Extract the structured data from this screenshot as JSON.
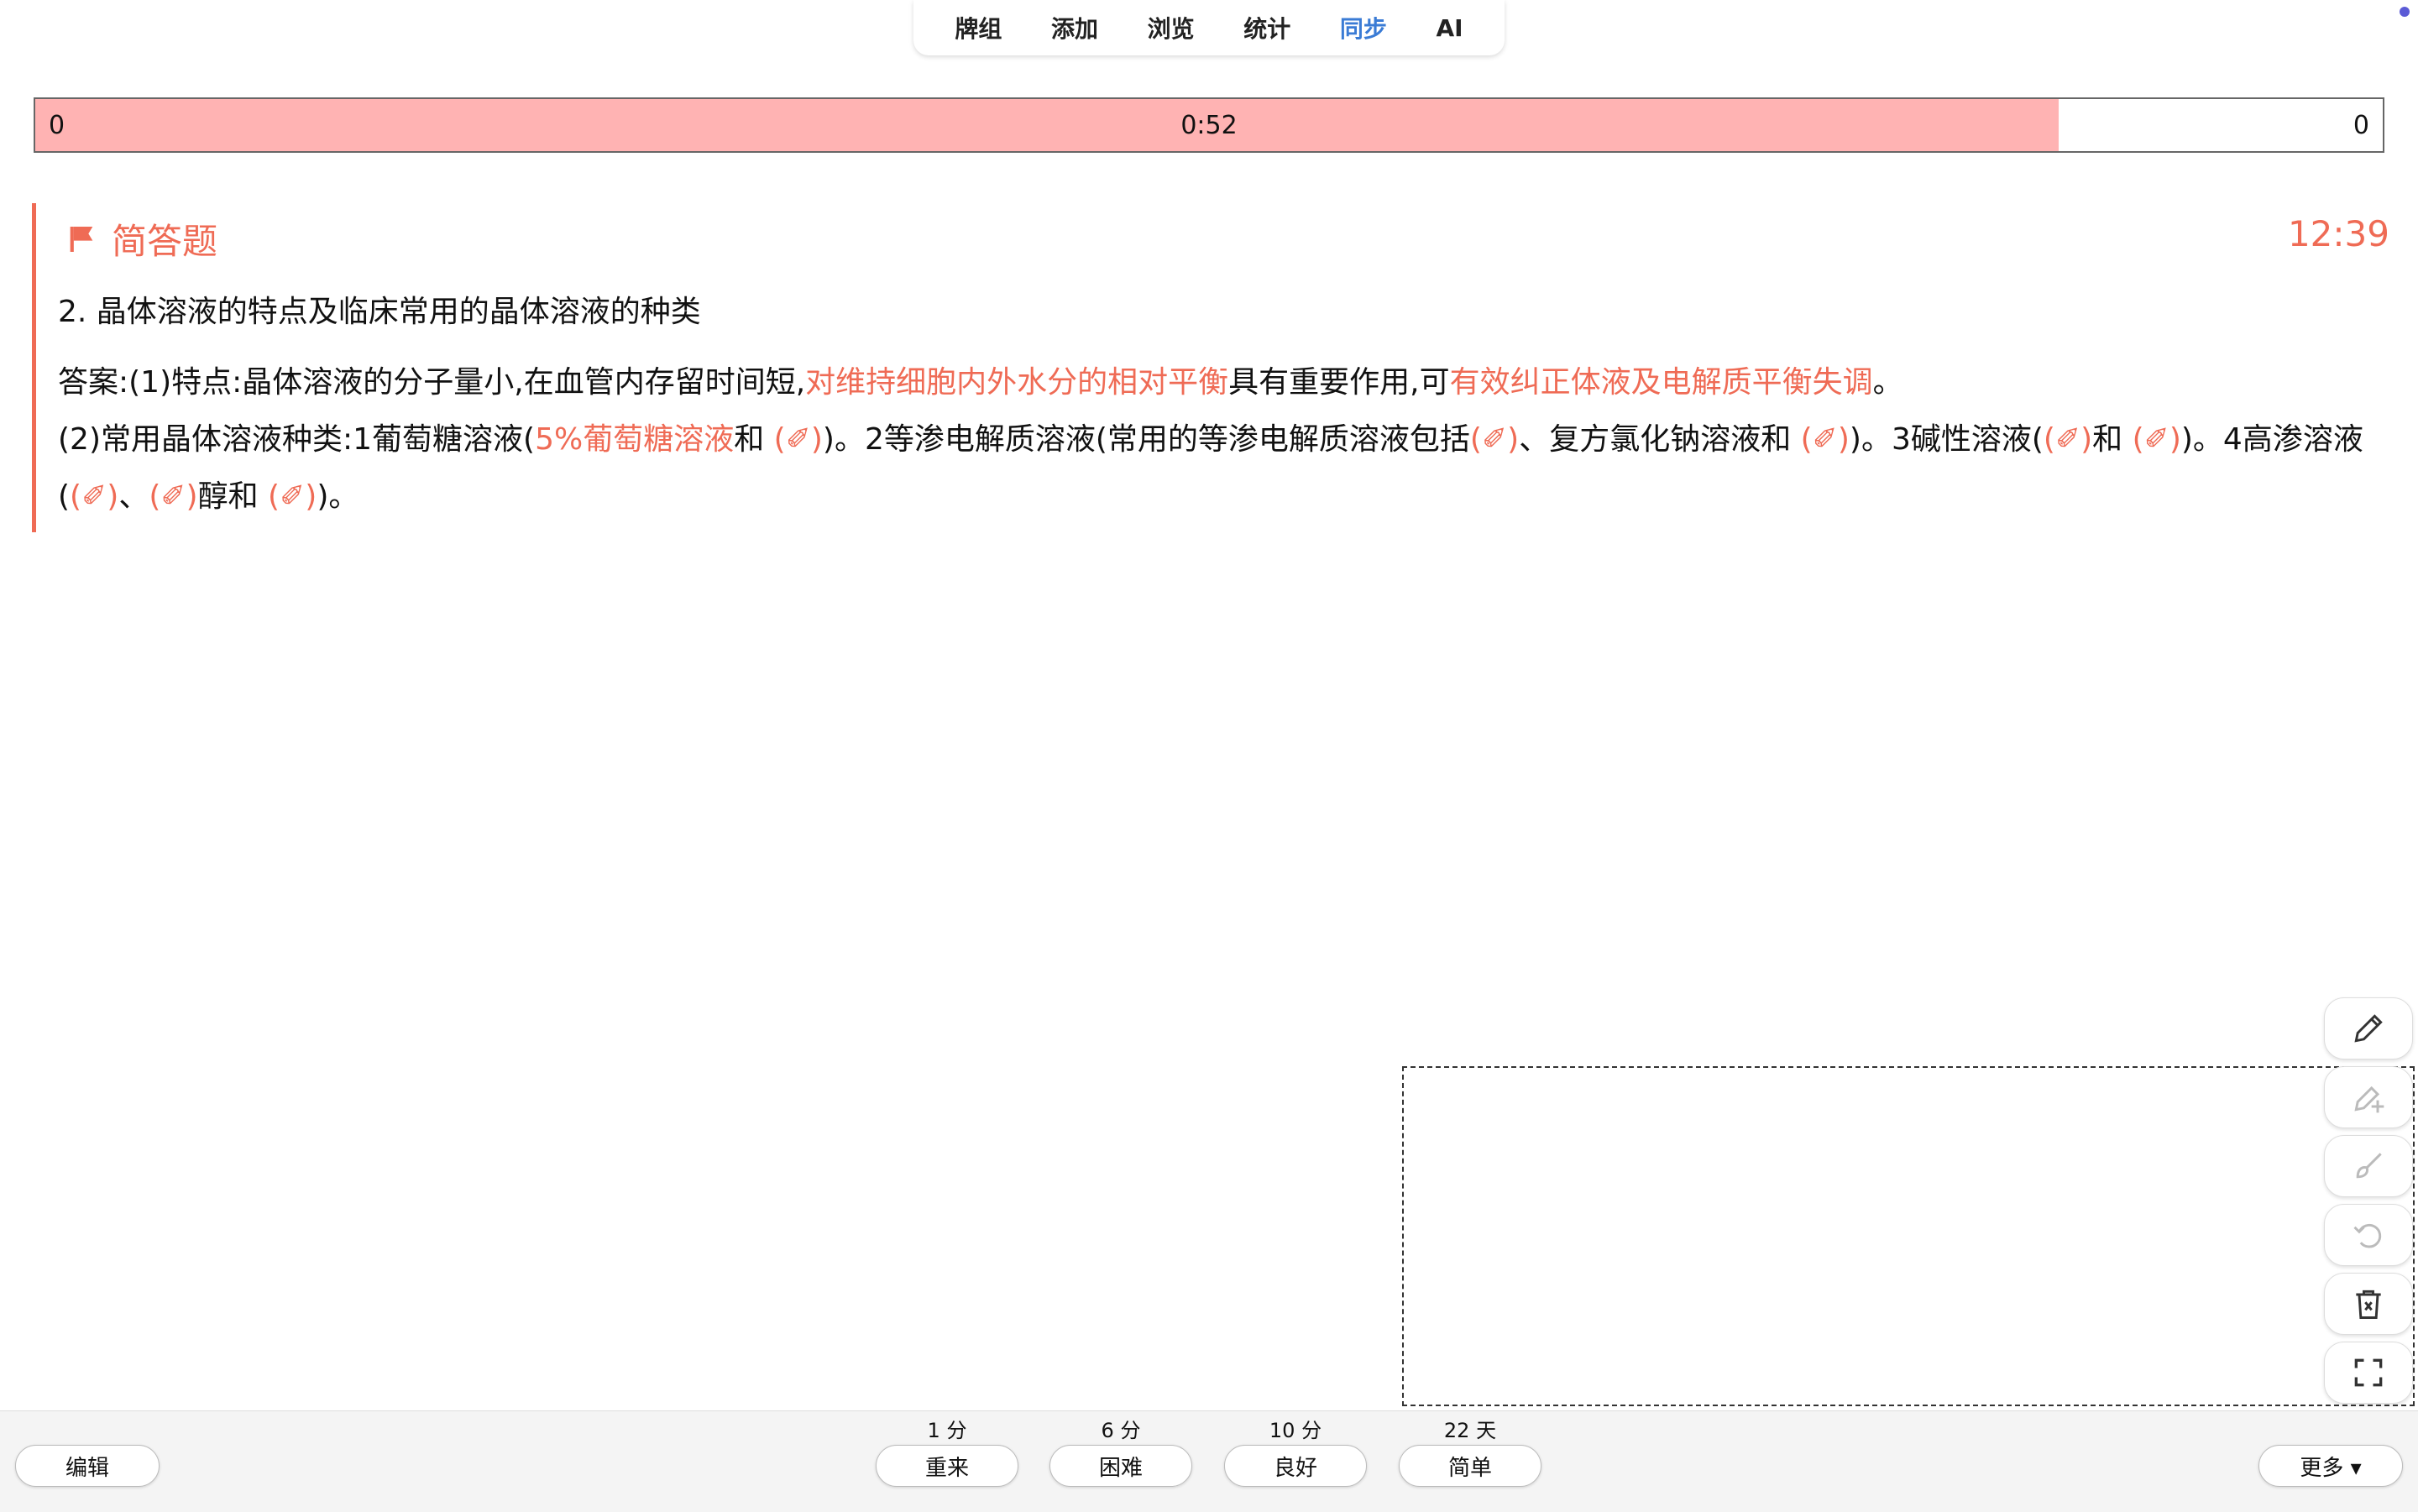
{
  "nav": {
    "items": [
      {
        "label": "牌组",
        "active": false
      },
      {
        "label": "添加",
        "active": false
      },
      {
        "label": "浏览",
        "active": false
      },
      {
        "label": "统计",
        "active": false
      },
      {
        "label": "同步",
        "active": true
      },
      {
        "label": "AI",
        "active": false
      }
    ]
  },
  "timer": {
    "left_count": "0",
    "elapsed": "0:52",
    "right_count": "0",
    "progress_fraction": 0.862,
    "fill_color": "#ffb3b3"
  },
  "card": {
    "type_label": "简答题",
    "clock": "12:39",
    "question": "2. 晶体溶液的特点及临床常用的晶体溶液的种类",
    "answer_segments": [
      {
        "text": "答案:(1)特点:晶体溶液的分子量小,在血管内存留时间短,",
        "hl": false
      },
      {
        "text": "对维持细胞内外水分的相对平衡",
        "hl": true
      },
      {
        "text": "具有重要作用,可",
        "hl": false
      },
      {
        "text": "有效纠正体液及电解质平衡失调",
        "hl": true
      },
      {
        "text": "。",
        "hl": false
      },
      {
        "text": "\n",
        "hl": false
      },
      {
        "text": "(2)常用晶体溶液种类:1葡萄糖溶液(",
        "hl": false
      },
      {
        "text": "5%葡萄糖溶液",
        "hl": true
      },
      {
        "text": "和 ",
        "hl": false
      },
      {
        "text": "(✐)",
        "hl": true
      },
      {
        "text": ")。2等渗电解质溶液(常用的等渗电解质溶液包括",
        "hl": false
      },
      {
        "text": "(✐)",
        "hl": true
      },
      {
        "text": "、复方氯化钠溶液和 ",
        "hl": false
      },
      {
        "text": "(✐)",
        "hl": true
      },
      {
        "text": ")。3碱性溶液(",
        "hl": false
      },
      {
        "text": "(✐)",
        "hl": true
      },
      {
        "text": "和 ",
        "hl": false
      },
      {
        "text": "(✐)",
        "hl": true
      },
      {
        "text": ")。4高渗溶液(",
        "hl": false
      },
      {
        "text": "(✐)",
        "hl": true
      },
      {
        "text": "、",
        "hl": false
      },
      {
        "text": "(✐)",
        "hl": true
      },
      {
        "text": "醇和 ",
        "hl": false
      },
      {
        "text": "(✐)",
        "hl": true
      },
      {
        "text": ")。",
        "hl": false
      }
    ]
  },
  "tools": [
    {
      "name": "pencil-icon",
      "enabled": true
    },
    {
      "name": "pencil-plus-icon",
      "enabled": false
    },
    {
      "name": "brush-icon",
      "enabled": false
    },
    {
      "name": "undo-icon",
      "enabled": false
    },
    {
      "name": "trash-icon",
      "enabled": true
    },
    {
      "name": "fullscreen-icon",
      "enabled": true
    }
  ],
  "bottom": {
    "edit_label": "编辑",
    "more_label": "更多 ▾",
    "answers": [
      {
        "label": "重来",
        "interval": "1 分"
      },
      {
        "label": "困难",
        "interval": "6 分"
      },
      {
        "label": "良好",
        "interval": "10 分"
      },
      {
        "label": "简单",
        "interval": "22 天"
      }
    ]
  },
  "colors": {
    "accent": "#ef6b55",
    "nav_active": "#3a7bd5"
  }
}
